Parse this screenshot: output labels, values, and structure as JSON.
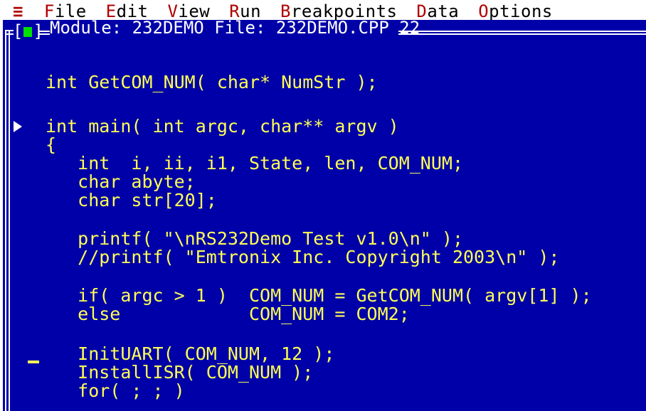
{
  "menu": {
    "system_icon": "≡",
    "items": [
      {
        "hot": "F",
        "rest": "ile"
      },
      {
        "hot": "E",
        "rest": "dit"
      },
      {
        "hot": "V",
        "rest": "iew"
      },
      {
        "hot": "R",
        "rest": "un"
      },
      {
        "hot": "B",
        "rest": "reakpoints"
      },
      {
        "hot": "D",
        "rest": "ata"
      },
      {
        "hot": "O",
        "rest": "ptions"
      }
    ]
  },
  "window": {
    "close_left": "[",
    "close_right": "]",
    "title": "Module: 232DEMO File: 232DEMO.CPP 22"
  },
  "code": {
    "lines": [
      "int GetCOM_NUM( char* NumStr );",
      "int main( int argc, char** argv )",
      "{",
      "   int  i, ii, i1, State, len, COM_NUM;",
      "   char abyte;",
      "   char str[20];",
      "   printf( \"\\nRS232Demo Test v1.0\\n\" );",
      "   //printf( \"Emtronix Inc. Copyright 2003\\n\" );",
      "   if( argc > 1 )  COM_NUM = GetCOM_NUM( argv[1] );",
      "   else            COM_NUM = COM2;",
      "   InitUART( COM_NUM, 12 );",
      "   InstallISR( COM_NUM );",
      "   for( ; ; )"
    ]
  },
  "colors": {
    "background": "#0000a8",
    "code_text": "#ffff55",
    "menu_hotkey": "#b00000",
    "close_box": "#00e000"
  }
}
